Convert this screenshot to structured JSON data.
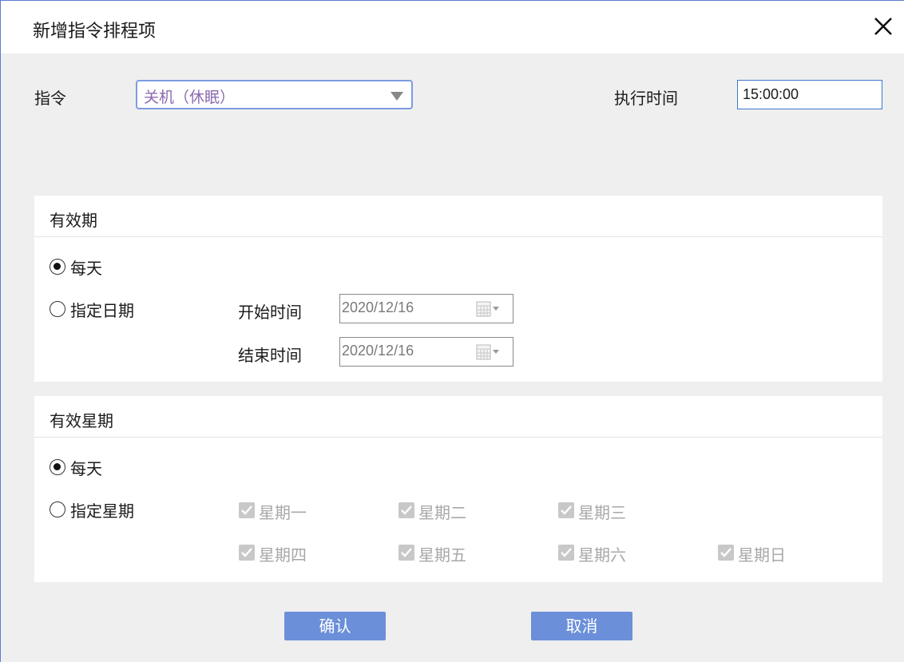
{
  "dialog": {
    "title": "新增指令排程项"
  },
  "command": {
    "label": "指令",
    "selected": "关机（休眠）",
    "exec_time_label": "执行时间",
    "exec_time_value": "15:00:00"
  },
  "validity": {
    "title": "有效期",
    "every_day": "每天",
    "specific_date": "指定日期",
    "start_label": "开始时间",
    "start_value": "2020/12/16",
    "end_label": "结束时间",
    "end_value": "2020/12/16",
    "selected_option": "every_day"
  },
  "weekdays": {
    "title": "有效星期",
    "every_day": "每天",
    "specific_week": "指定星期",
    "selected_option": "every_day",
    "days": [
      {
        "label": "星期一",
        "checked": true
      },
      {
        "label": "星期二",
        "checked": true
      },
      {
        "label": "星期三",
        "checked": true
      },
      {
        "label": "星期四",
        "checked": true
      },
      {
        "label": "星期五",
        "checked": true
      },
      {
        "label": "星期六",
        "checked": true
      },
      {
        "label": "星期日",
        "checked": true
      }
    ]
  },
  "buttons": {
    "confirm": "确认",
    "cancel": "取消"
  },
  "icons": {
    "close": "close-icon",
    "dropdown": "chevron-down-icon",
    "calendar": "calendar-icon",
    "check": "checkmark-icon"
  },
  "colors": {
    "accent": "#6b8fd9",
    "select_border": "#7d9be0",
    "select_text": "#8a6ab0",
    "background": "#efefef"
  }
}
